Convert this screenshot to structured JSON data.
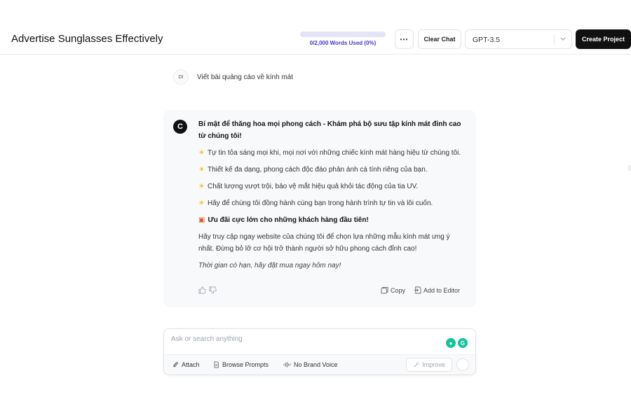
{
  "header": {
    "title": "Advertise Sunglasses Effectively",
    "usage_text": "0/2,000 Words Used (0%)",
    "usage_fraction": 0.0,
    "more_icon": "more-horizontal-icon",
    "clear_label": "Clear Chat",
    "model_value": "GPT-3.5",
    "create_label": "Create Project"
  },
  "chat": {
    "user": {
      "initials": "DI",
      "text": "Viết bài quảng cáo về kính mát"
    },
    "assistant": {
      "avatar": "C",
      "headline": "Bí mật để thăng hoa mọi phong cách - Khám phá bộ sưu tập kính mát đỉnh cao từ chúng tôi!",
      "bullets": [
        "Tự tin tỏa sáng mọi khi, mọi nơi với những chiếc kính mát hàng hiệu từ chúng tôi.",
        "Thiết kế đa dạng, phong cách độc đáo phản ánh cá tính riêng của bạn.",
        "Chất lượng vượt trội, bảo vệ mắt hiệu quả khỏi tác động của tia UV.",
        "Hãy để chúng tôi đồng hành cùng bạn trong hành trình tự tin và lôi cuốn."
      ],
      "offer": "Ưu đãi cực lớn cho những khách hàng đầu tiên!",
      "cta": "Hãy truy cập ngay website của chúng tôi để chọn lựa những mẫu kính mát ưng ý nhất. Đừng bỏ lỡ cơ hội trở thành người sở hữu phong cách đỉnh cao!",
      "closing": "Thời gian có hạn, hãy đặt mua ngay hôm nay!",
      "copy_label": "Copy",
      "editor_label": "Add to Editor"
    }
  },
  "composer": {
    "placeholder": "Ask or search anything",
    "attach_label": "Attach",
    "prompts_label": "Browse Prompts",
    "voice_label": "No Brand Voice",
    "improve_label": "Improve"
  },
  "colors": {
    "accent": "#7c6cf0",
    "primary_button": "#111111",
    "grammarly_green": "#15c39a"
  }
}
